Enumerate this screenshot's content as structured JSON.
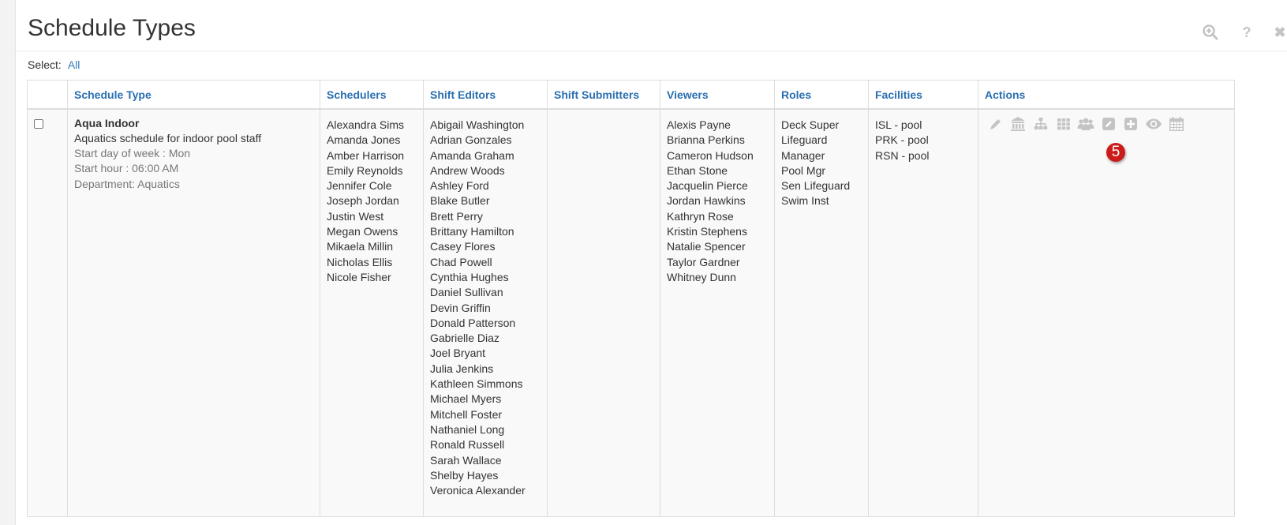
{
  "header": {
    "title": "Schedule Types",
    "tools": [
      "zoom-icon",
      "help-icon",
      "close-icon"
    ],
    "help_label": "?",
    "close_label": "✖"
  },
  "select": {
    "label": "Select:",
    "all_link": "All"
  },
  "table": {
    "columns": [
      "Schedule Type",
      "Schedulers",
      "Shift Editors",
      "Shift Submitters",
      "Viewers",
      "Roles",
      "Facilities",
      "Actions"
    ],
    "rows": [
      {
        "checked": false,
        "schedule_type": {
          "name": "Aqua Indoor",
          "description": "Aquatics schedule for indoor pool staff",
          "start_day": "Start day of week : Mon",
          "start_hour": "Start hour : 06:00 AM",
          "department": "Department: Aquatics"
        },
        "schedulers": [
          "Alexandra Sims",
          "Amanda Jones",
          "Amber Harrison",
          "Emily Reynolds",
          "Jennifer Cole",
          "Joseph Jordan",
          "Justin West",
          "Megan Owens",
          "Mikaela Millin",
          "Nicholas Ellis",
          "Nicole Fisher"
        ],
        "shift_editors": [
          "Abigail Washington",
          "Adrian Gonzales",
          "Amanda Graham",
          "Andrew Woods",
          "Ashley Ford",
          "Blake Butler",
          "Brett Perry",
          "Brittany Hamilton",
          "Casey Flores",
          "Chad Powell",
          "Cynthia Hughes",
          "Daniel Sullivan",
          "Devin Griffin",
          "Donald Patterson",
          "Gabrielle Diaz",
          "Joel Bryant",
          "Julia Jenkins",
          "Kathleen Simmons",
          "Michael Myers",
          "Mitchell Foster",
          "Nathaniel Long",
          "Ronald Russell",
          "Sarah Wallace",
          "Shelby Hayes",
          "Veronica Alexander"
        ],
        "shift_submitters": [],
        "viewers": [
          "Alexis Payne",
          "Brianna Perkins",
          "Cameron Hudson",
          "Ethan Stone",
          "Jacquelin Pierce",
          "Jordan Hawkins",
          "Kathryn Rose",
          "Kristin Stephens",
          "Natalie Spencer",
          "Taylor Gardner",
          "Whitney Dunn"
        ],
        "roles": [
          "Deck Super",
          "Lifeguard",
          "Manager",
          "Pool Mgr",
          "Sen Lifeguard",
          "Swim Inst"
        ],
        "facilities": [
          "ISL - pool",
          "PRK - pool",
          "RSN - pool"
        ],
        "actions": [
          "pencil-icon",
          "institution-icon",
          "sitemap-icon",
          "grid-icon",
          "users-icon",
          "edit-square-icon",
          "plus-square-icon",
          "eye-icon",
          "calendar-icon"
        ],
        "badge": "5"
      }
    ]
  },
  "colors": {
    "link": "#337ab7",
    "header_text": "#2a6fb0",
    "icon": "#c4c4c4",
    "badge": "#cc1b1b"
  }
}
